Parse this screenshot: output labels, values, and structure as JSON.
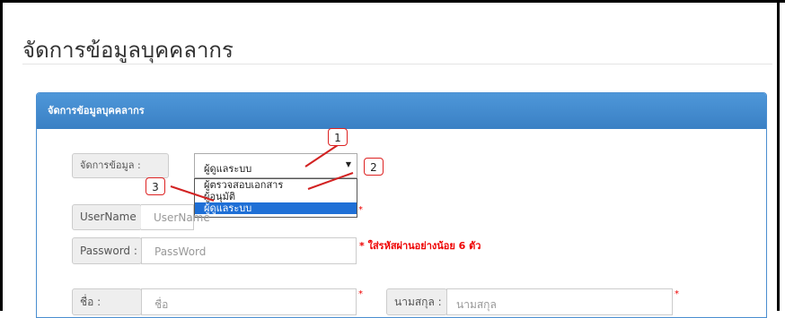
{
  "page": {
    "title": "จัดการข้อมูลบุคคลากร"
  },
  "panel": {
    "heading": "จัดการข้อมูลบุคคลากร"
  },
  "manage": {
    "label": "จัดการข้อมูล :",
    "selected": "ผู้ดูแลระบบ",
    "options": [
      "ผู้ตรวจสอบเอกสาร",
      "ผู้อนุมัติ",
      "ผู้ดูแลระบบ"
    ],
    "arrow": "▼"
  },
  "username": {
    "label": "UserName :",
    "placeholder": "UserName"
  },
  "password": {
    "label": "Password :",
    "placeholder": "PassWord",
    "hint": "* ใส่รหัสผ่านอย่างน้อย 6 ตัว"
  },
  "firstname": {
    "label": "ชื่อ :",
    "placeholder": "ชื่อ"
  },
  "lastname": {
    "label": "นามสกุล :",
    "placeholder": "นามสกุล"
  },
  "required_mark": "*",
  "annotations": {
    "one": "1",
    "two": "2",
    "three": "3"
  },
  "colors": {
    "panel_header": "#3f87cb",
    "highlight": "#1e6fd6",
    "callout": "#d22222",
    "required": "#ee0000"
  }
}
